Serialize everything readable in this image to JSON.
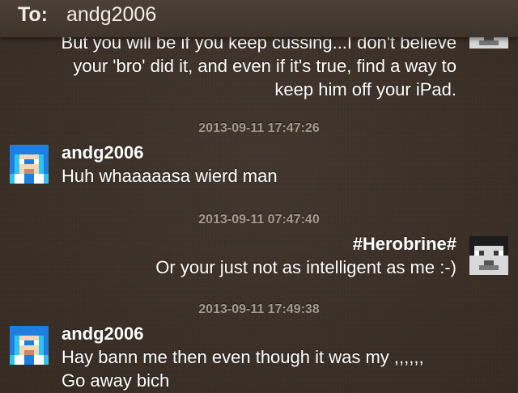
{
  "header": {
    "to_label": "To:",
    "recipient": "andg2006"
  },
  "messages": [
    {
      "side": "right",
      "sender": "",
      "lines": [
        "But you will be if you keep cussing...I don't believe",
        "your 'bro' did it, and even if it's true, find a way to",
        "keep him off your iPad."
      ]
    },
    {
      "timestamp": "2013-09-11 17:47:26",
      "side": "left",
      "sender": "andg2006",
      "lines": [
        "Huh whaaaaasa wierd man"
      ]
    },
    {
      "timestamp": "2013-09-11 07:47:40",
      "side": "right",
      "sender": "#Herobrine#",
      "lines": [
        "Or your just not as intelligent as me :-)"
      ]
    },
    {
      "timestamp": "2013-09-11 17:49:38",
      "side": "left",
      "sender": "andg2006",
      "lines": [
        "Hay bann me then even though it was my ,,,,,,",
        "Go away bich"
      ]
    }
  ],
  "avatars": {
    "andg2006": "blue-pixel-avatar-icon",
    "herobrine": "grey-pixel-face-avatar-icon"
  },
  "colors": {
    "background": "#3a2f27",
    "header": "#463a31",
    "timestamp": "#a6998c",
    "text": "#ffffff",
    "avatar_blue": "#1e7fe0",
    "avatar_cyan": "#2fc4f0"
  }
}
